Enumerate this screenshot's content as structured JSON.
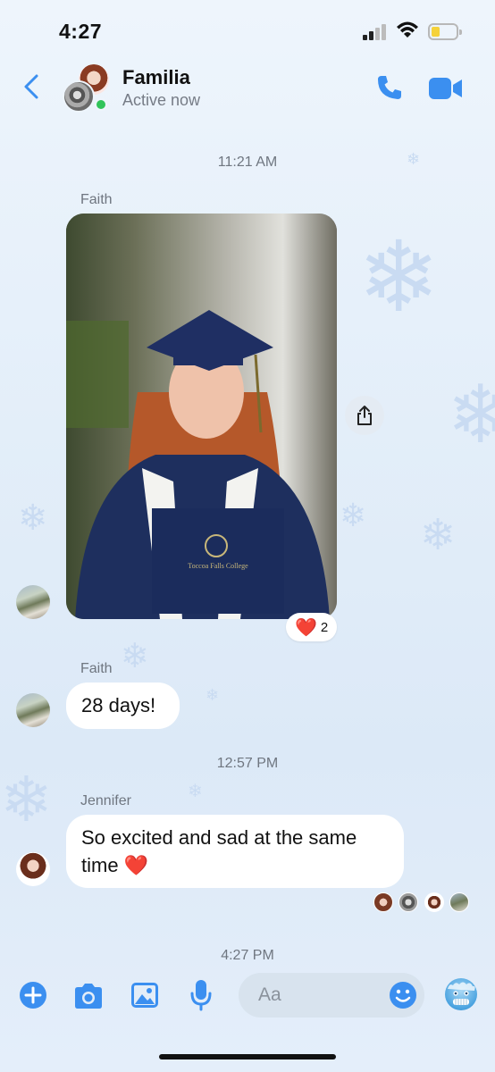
{
  "status_bar": {
    "time": "4:27"
  },
  "header": {
    "name": "Familia",
    "status": "Active now"
  },
  "messages": {
    "timestamp_1": "11:21 AM",
    "sender_1": "Faith",
    "photo_reaction": {
      "emoji": "❤️",
      "count": "2"
    },
    "sender_2": "Faith",
    "text_1": "28 days!",
    "timestamp_2": "12:57 PM",
    "sender_3": "Jennifer",
    "text_2": "So excited and sad at the same time ❤️",
    "timestamp_3": "4:27 PM"
  },
  "photo": {
    "diploma_text": "Toccoa Falls College"
  },
  "composer": {
    "placeholder": "Aa"
  },
  "colors": {
    "accent": "#3b8ff0",
    "online": "#31c45a",
    "bubble": "#ffffff"
  },
  "icons": [
    "back-chevron",
    "phone",
    "video-camera",
    "share",
    "plus",
    "camera",
    "gallery",
    "microphone",
    "smile",
    "cold-face-emoji"
  ]
}
